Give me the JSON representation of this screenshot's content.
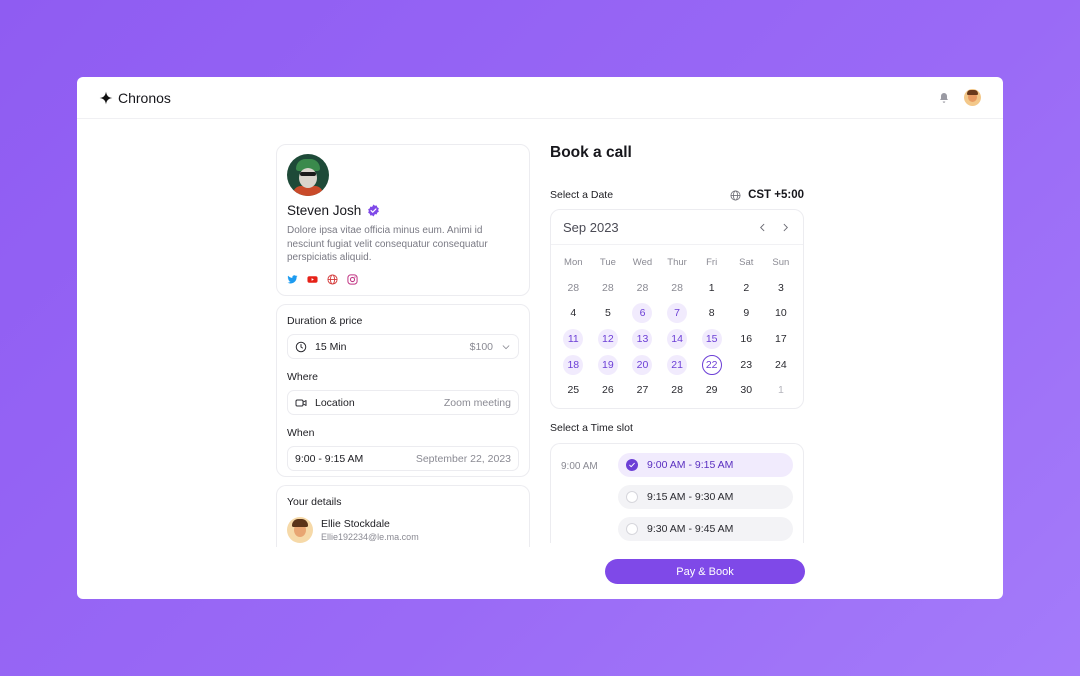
{
  "app": {
    "name": "Chronos"
  },
  "header": {
    "notification_icon": "bell-icon",
    "avatar": "user-avatar"
  },
  "profile": {
    "name": "Steven Josh",
    "bio": "Dolore ipsa vitae officia minus eum. Animi id nesciunt fugiat velit consequatur consequatur perspiciatis aliquid.",
    "socials": [
      "twitter-icon",
      "youtube-icon",
      "globe-icon",
      "instagram-icon"
    ]
  },
  "booking": {
    "duration_label": "Duration & price",
    "duration_value": "15 Min",
    "price": "$100",
    "where_label": "Where",
    "where_value": "Location",
    "where_detail": "Zoom meeting",
    "when_label": "When",
    "when_value": "9:00 - 9:15 AM",
    "when_date": "September 22, 2023"
  },
  "details": {
    "label": "Your details",
    "name": "Ellie Stockdale",
    "email": "Ellie192234@le.ma.com"
  },
  "calendar": {
    "title": "Book a call",
    "select_date_label": "Select a Date",
    "timezone": "CST +5:00",
    "month": "Sep 2023",
    "weekdays": [
      "Mon",
      "Tue",
      "Wed",
      "Thur",
      "Fri",
      "Sat",
      "Sun"
    ],
    "days": [
      {
        "d": "28",
        "s": "muted"
      },
      {
        "d": "28",
        "s": "muted"
      },
      {
        "d": "28",
        "s": "muted"
      },
      {
        "d": "28",
        "s": "muted"
      },
      {
        "d": "1",
        "s": ""
      },
      {
        "d": "2",
        "s": ""
      },
      {
        "d": "3",
        "s": ""
      },
      {
        "d": "4",
        "s": ""
      },
      {
        "d": "5",
        "s": ""
      },
      {
        "d": "6",
        "s": "avail"
      },
      {
        "d": "7",
        "s": "avail"
      },
      {
        "d": "8",
        "s": ""
      },
      {
        "d": "9",
        "s": ""
      },
      {
        "d": "10",
        "s": ""
      },
      {
        "d": "11",
        "s": "avail"
      },
      {
        "d": "12",
        "s": "avail"
      },
      {
        "d": "13",
        "s": "avail"
      },
      {
        "d": "14",
        "s": "avail"
      },
      {
        "d": "15",
        "s": "avail"
      },
      {
        "d": "16",
        "s": ""
      },
      {
        "d": "17",
        "s": ""
      },
      {
        "d": "18",
        "s": "avail"
      },
      {
        "d": "19",
        "s": "avail"
      },
      {
        "d": "20",
        "s": "avail"
      },
      {
        "d": "21",
        "s": "avail"
      },
      {
        "d": "22",
        "s": "sel"
      },
      {
        "d": "23",
        "s": ""
      },
      {
        "d": "24",
        "s": ""
      },
      {
        "d": "25",
        "s": ""
      },
      {
        "d": "26",
        "s": ""
      },
      {
        "d": "27",
        "s": ""
      },
      {
        "d": "28",
        "s": ""
      },
      {
        "d": "29",
        "s": ""
      },
      {
        "d": "30",
        "s": ""
      },
      {
        "d": "1",
        "s": "faint"
      }
    ],
    "selected_day": "22"
  },
  "timeslots": {
    "label": "Select a Time slot",
    "group_time": "9:00 AM",
    "slots": [
      {
        "label": "9:00 AM - 9:15 AM",
        "selected": true
      },
      {
        "label": "9:15 AM - 9:30 AM",
        "selected": false
      },
      {
        "label": "9:30 AM - 9:45 AM",
        "selected": false
      }
    ]
  },
  "actions": {
    "pay_label": "Pay & Book"
  },
  "colors": {
    "accent": "#7f49e8",
    "background": "#9a6af6",
    "available_day": "#f1ebfd"
  }
}
